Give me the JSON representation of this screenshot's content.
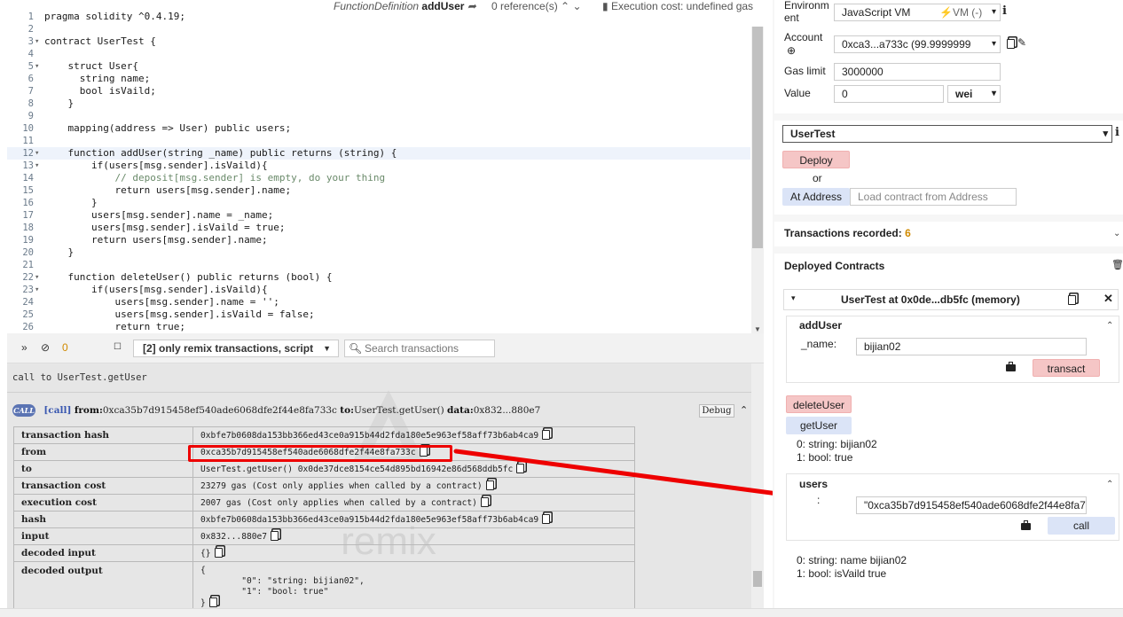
{
  "editor": {
    "function_def_label": "FunctionDefinition",
    "function_name": "addUser",
    "references": "0 reference(s)",
    "execution_cost": "Execution cost: undefined gas",
    "lines": [
      {
        "n": "1",
        "fold": "",
        "code": "pragma solidity ^0.4.19;"
      },
      {
        "n": "2",
        "fold": "",
        "code": ""
      },
      {
        "n": "3",
        "fold": "▾",
        "code": "contract UserTest {"
      },
      {
        "n": "4",
        "fold": "",
        "code": ""
      },
      {
        "n": "5",
        "fold": "▾",
        "code": "    struct User{"
      },
      {
        "n": "6",
        "fold": "",
        "code": "      string name;"
      },
      {
        "n": "7",
        "fold": "",
        "code": "      bool isVaild;"
      },
      {
        "n": "8",
        "fold": "",
        "code": "    }"
      },
      {
        "n": "9",
        "fold": "",
        "code": ""
      },
      {
        "n": "10",
        "fold": "",
        "code": "    mapping(address => User) public users;"
      },
      {
        "n": "11",
        "fold": "",
        "code": ""
      },
      {
        "n": "12",
        "fold": "▾",
        "code": "    function addUser(string _name) public returns (string) {"
      },
      {
        "n": "13",
        "fold": "▾",
        "code": "        if(users[msg.sender].isVaild){"
      },
      {
        "n": "14",
        "fold": "",
        "code": "            // deposit[msg.sender] is empty, do your thing"
      },
      {
        "n": "15",
        "fold": "",
        "code": "            return users[msg.sender].name;"
      },
      {
        "n": "16",
        "fold": "",
        "code": "        }"
      },
      {
        "n": "17",
        "fold": "",
        "code": "        users[msg.sender].name = _name;"
      },
      {
        "n": "18",
        "fold": "",
        "code": "        users[msg.sender].isVaild = true;"
      },
      {
        "n": "19",
        "fold": "",
        "code": "        return users[msg.sender].name;"
      },
      {
        "n": "20",
        "fold": "",
        "code": "    }"
      },
      {
        "n": "21",
        "fold": "",
        "code": ""
      },
      {
        "n": "22",
        "fold": "▾",
        "code": "    function deleteUser() public returns (bool) {"
      },
      {
        "n": "23",
        "fold": "▾",
        "code": "        if(users[msg.sender].isVaild){"
      },
      {
        "n": "24",
        "fold": "",
        "code": "            users[msg.sender].name = '';"
      },
      {
        "n": "25",
        "fold": "",
        "code": "            users[msg.sender].isVaild = false;"
      },
      {
        "n": "26",
        "fold": "",
        "code": "            return true;"
      }
    ]
  },
  "terminal_bar": {
    "collapse_icon": "double-chevron-down-icon",
    "clear_icon": "ban-icon",
    "pending_count": "0",
    "filter_label": "[2] only remix transactions, script",
    "search_placeholder": "Search transactions"
  },
  "terminal": {
    "call_line": "call to UserTest.getUser",
    "watermark": "remix",
    "tx_badge": "CALL",
    "tx_tag": "[call]",
    "tx_from_label": "from:",
    "tx_from": "0xca35b7d915458ef540ade6068dfe2f44e8fa733c",
    "tx_to_label": "to:",
    "tx_to": "UserTest.getUser()",
    "tx_data_label": "data:",
    "tx_data": "0x832...880e7",
    "debug_label": "Debug",
    "rows": [
      {
        "key": "transaction hash",
        "value": "0xbfe7b0608da153bb366ed43ce0a915b44d2fda180e5e963ef58aff73b6ab4ca9"
      },
      {
        "key": "from",
        "value": "0xca35b7d915458ef540ade6068dfe2f44e8fa733c"
      },
      {
        "key": "to",
        "value": "UserTest.getUser() 0x0de37dce8154ce54d895bd16942e86d568ddb5fc"
      },
      {
        "key": "transaction cost",
        "value": "23279 gas (Cost only applies when called by a contract)"
      },
      {
        "key": "execution cost",
        "value": "2007 gas (Cost only applies when called by a contract)"
      },
      {
        "key": "hash",
        "value": "0xbfe7b0608da153bb366ed43ce0a915b44d2fda180e5e963ef58aff73b6ab4ca9"
      },
      {
        "key": "input",
        "value": "0x832...880e7"
      },
      {
        "key": "decoded input",
        "value": "{}"
      }
    ],
    "decoded_output_key": "decoded output",
    "decoded_output_value": "{\n        \"0\": \"string: bijian02\",\n        \"1\": \"bool: true\"\n}"
  },
  "right": {
    "environment_label": "Environm\nent",
    "environment_value": "JavaScript VM",
    "vm_badge": "VM (-)",
    "account_label": "Account",
    "account_value": "0xca3...a733c (99.9999999",
    "gas_limit_label": "Gas limit",
    "gas_limit_value": "3000000",
    "value_label": "Value",
    "value_value": "0",
    "value_unit": "wei",
    "contract_select": "UserTest",
    "deploy_label": "Deploy",
    "or_label": "or",
    "at_address_label": "At Address",
    "at_address_placeholder": "Load contract from Address",
    "tx_recorded_label": "Transactions recorded:",
    "tx_recorded_count": "6",
    "deployed_label": "Deployed Contracts",
    "instance_title": "UserTest at 0x0de...db5fc (memory)",
    "adduser_title": "addUser",
    "adduser_param": "_name:",
    "adduser_value": "bijian02",
    "transact_label": "transact",
    "deleteuser_label": "deleteUser",
    "getuser_label": "getUser",
    "getuser_result_0": "0: string: bijian02",
    "getuser_result_1": "1: bool: true",
    "users_title": "users",
    "users_param": ":",
    "users_value": "\"0xca35b7d915458ef540ade6068dfe2f44e8fa7",
    "call_label": "call",
    "users_result_0": "0: string: name bijian02",
    "users_result_1": "1: bool: isVaild true"
  },
  "colors": {
    "annotation": "#e00000",
    "deploy_button": "#f5c6c6",
    "call_button": "#dbe4f7"
  }
}
